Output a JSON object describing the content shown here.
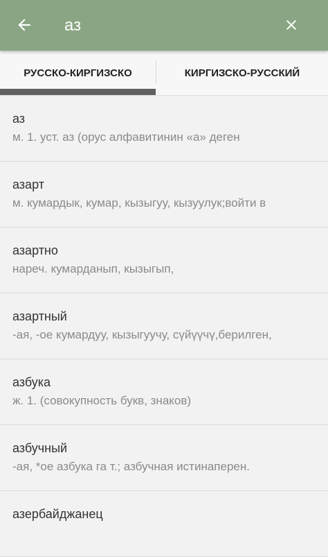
{
  "header": {
    "back_icon": "arrow-left-icon",
    "search_value": "аз",
    "clear_icon": "close-icon",
    "bar_color": "#8aa583"
  },
  "tabs": [
    {
      "label": "РУССКО-КИРГИЗСКО",
      "selected": true
    },
    {
      "label": "КИРГИЗСКО-РУССКИЙ",
      "selected": false
    }
  ],
  "results": [
    {
      "word": "аз",
      "definition": "м. 1. уст. аз (орус алфавитинин «а» деген"
    },
    {
      "word": "азарт",
      "definition": "м. кумардык, кумар, кызыгуу, кызуулук;войти в"
    },
    {
      "word": "азартно",
      "definition": "нареч. кумарданып, кызыгып,"
    },
    {
      "word": "азартный",
      "definition": "-ая, -ое кумардуу, кызыгуучу, сүйүүчү,берилген,"
    },
    {
      "word": "азбука",
      "definition": "ж. 1. (совокупность букв, знаков)"
    },
    {
      "word": "азбучный",
      "definition": "-ая, *ое азбука га т.; азбучная истинаперен."
    },
    {
      "word": "азербайджанец",
      "definition": ""
    }
  ]
}
